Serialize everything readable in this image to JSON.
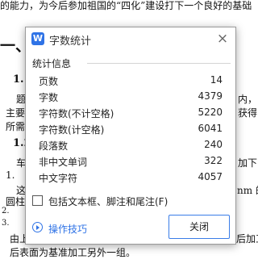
{
  "document": {
    "lines": [
      "的能力，为今后参加祖国的“四化”建设打下一个良好的基础",
      "一、",
      "1.1",
      "题",
      "主要",
      "所需",
      "1.2",
      "车",
      "1.",
      "这",
      "圆柱",
      "2.",
      "3.",
      "由上",
      "后表面为基准加工另外一组。",
      "内，",
      "获得",
      "加下",
      "nm 的",
      "后加工"
    ]
  },
  "dialog": {
    "app_icon": "W",
    "title": "字数统计",
    "close_icon": "×",
    "section_label": "统计信息",
    "stats": [
      {
        "label": "页数",
        "value": "14"
      },
      {
        "label": "字数",
        "value": "4379"
      },
      {
        "label": "字符数(不计空格)",
        "value": "5220"
      },
      {
        "label": "字符数(计空格)",
        "value": "6041"
      },
      {
        "label": "段落数",
        "value": "240"
      },
      {
        "label": "非中文单词",
        "value": "322"
      },
      {
        "label": "中文字符",
        "value": "4057"
      }
    ],
    "checkbox_label": "包括文本框、脚注和尾注(F)",
    "checkbox_checked": false,
    "tips_label": "操作技巧",
    "close_button_label": "关闭"
  }
}
